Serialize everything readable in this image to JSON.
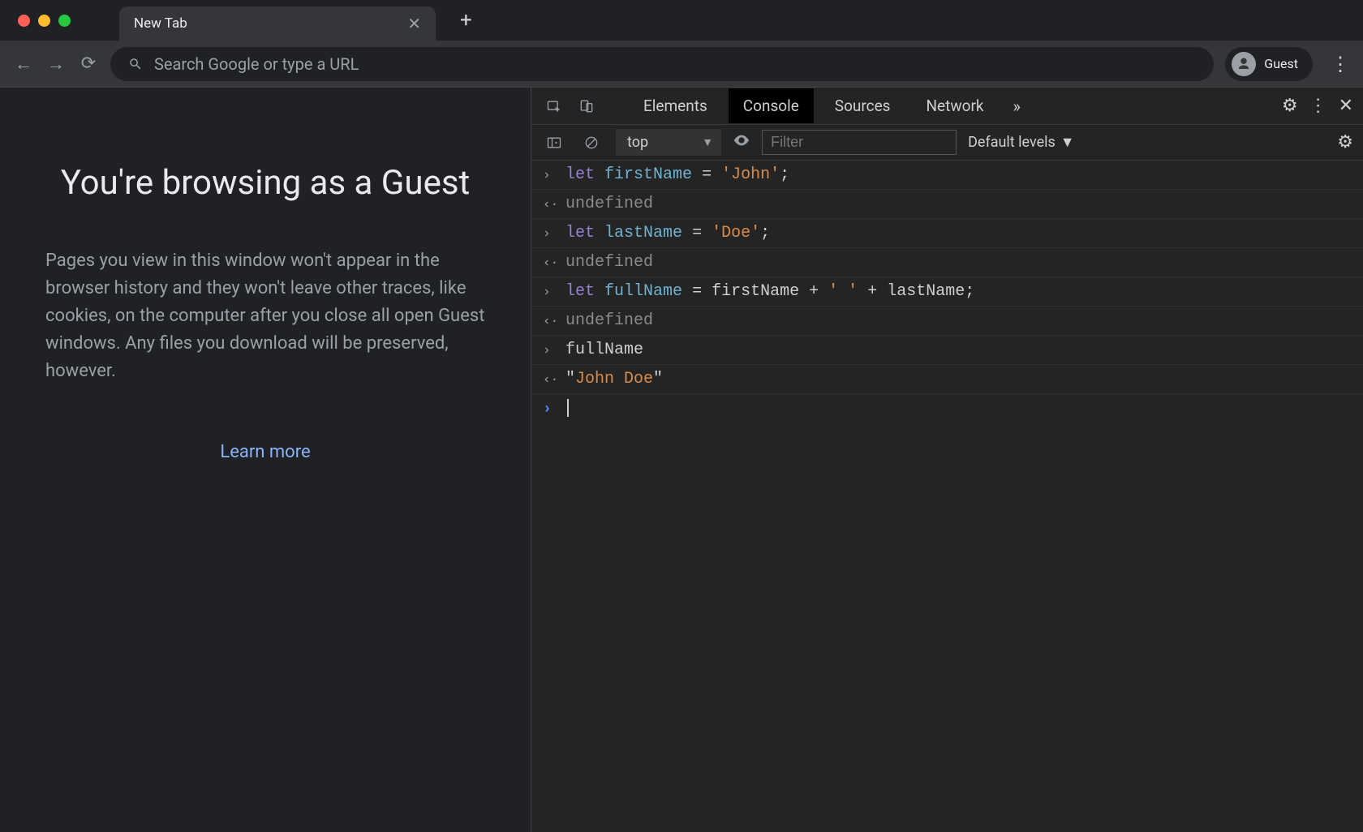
{
  "tab": {
    "title": "New Tab"
  },
  "addressbar": {
    "placeholder": "Search Google or type a URL"
  },
  "profile": {
    "label": "Guest"
  },
  "guest": {
    "title": "You're browsing as a Guest",
    "body": "Pages you view in this window won't appear in the browser history and they won't leave other traces, like cookies, on the computer after you close all open Guest windows. Any files you download will be preserved, however.",
    "learn_more": "Learn more"
  },
  "devtools": {
    "tabs": {
      "elements": "Elements",
      "console": "Console",
      "sources": "Sources",
      "network": "Network"
    },
    "context": "top",
    "filter_placeholder": "Filter",
    "levels": "Default levels",
    "console": {
      "lines": [
        {
          "type": "input_declare",
          "keyword": "let",
          "var": "firstName",
          "string": "'John'"
        },
        {
          "type": "output_undef",
          "text": "undefined"
        },
        {
          "type": "input_declare",
          "keyword": "let",
          "var": "lastName",
          "string": "'Doe'"
        },
        {
          "type": "output_undef",
          "text": "undefined"
        },
        {
          "type": "input_concat",
          "keyword": "let",
          "var": "fullName",
          "a": "firstName",
          "b": "lastName",
          "space": "' '"
        },
        {
          "type": "output_undef",
          "text": "undefined"
        },
        {
          "type": "input_expr",
          "expr": "fullName"
        },
        {
          "type": "output_string",
          "value": "John Doe"
        }
      ]
    }
  }
}
